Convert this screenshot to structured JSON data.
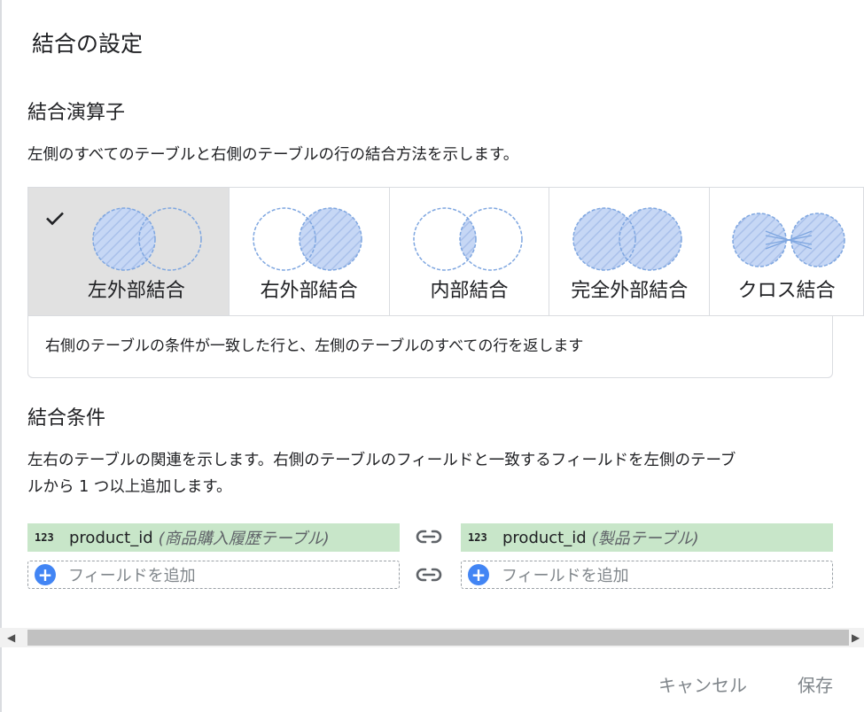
{
  "dialog": {
    "title": "結合の設定"
  },
  "operator_section": {
    "title": "結合演算子",
    "description": "左側のすべてのテーブルと右側のテーブルの行の結合方法を示します。",
    "join_types": [
      {
        "label": "左外部結合",
        "selected": true,
        "icon": "left-join-venn-icon"
      },
      {
        "label": "右外部結合",
        "selected": false,
        "icon": "right-join-venn-icon"
      },
      {
        "label": "内部結合",
        "selected": false,
        "icon": "inner-join-venn-icon"
      },
      {
        "label": "完全外部結合",
        "selected": false,
        "icon": "full-join-venn-icon"
      },
      {
        "label": "クロス結合",
        "selected": false,
        "icon": "cross-join-venn-icon"
      }
    ],
    "selected_explanation": "右側のテーブルの条件が一致した行と、左側のテーブルのすべての行を返します"
  },
  "condition_section": {
    "title": "結合条件",
    "description_line1": "左右のテーブルの関連を示します。右側のテーブルのフィールドと一致するフィールドを左側のテーブ",
    "description_line2": "ルから 1 つ以上追加します。",
    "left_field": {
      "type_badge": "123",
      "name": "product_id",
      "table": "(商品購入履歴テーブル)"
    },
    "right_field": {
      "type_badge": "123",
      "name": "product_id",
      "table": "(製品テーブル)"
    },
    "add_field_label": "フィールドを追加",
    "add_icon_glyph": "+"
  },
  "scrollbar": {
    "left_arrow": "◀",
    "right_arrow": "▶"
  },
  "footer": {
    "cancel_label": "キャンセル",
    "save_label": "保存"
  },
  "colors": {
    "venn_fill": "#c6d7f5",
    "venn_stroke": "#7ea6e0",
    "selected_bg": "#e1e1e1",
    "field_green": "#c8e6c9",
    "add_blue": "#4285f4"
  }
}
